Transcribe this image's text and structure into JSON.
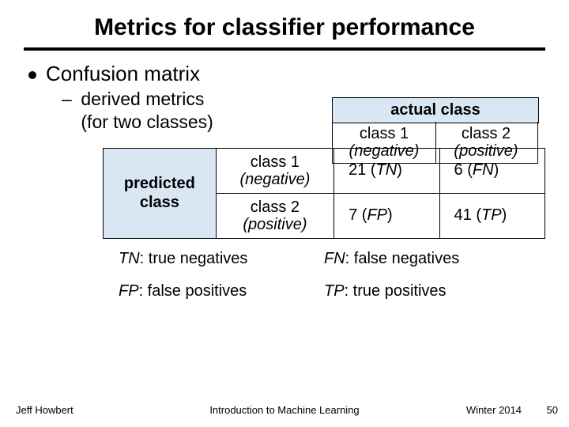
{
  "title": "Metrics for classifier performance",
  "bullet": "Confusion matrix",
  "sub_bullet_line1": "derived metrics",
  "sub_bullet_line2": "(for two classes)",
  "table": {
    "actual_header": "actual class",
    "predicted_header_line1": "predicted",
    "predicted_header_line2": "class",
    "col1_label": "class 1",
    "col1_paren": "(negative)",
    "col2_label": "class 2",
    "col2_paren": "(positive)",
    "row1_label": "class 1",
    "row1_paren": "(negative)",
    "row2_label": "class 2",
    "row2_paren": "(positive)",
    "cells": {
      "r1c1_num": "21",
      "r1c1_abbr": "TN",
      "r1c2_num": "6",
      "r1c2_abbr": "FN",
      "r2c1_num": "7",
      "r2c1_abbr": "FP",
      "r2c2_num": "41",
      "r2c2_abbr": "TP"
    }
  },
  "legend": {
    "tn_abbr": "TN",
    "tn_text": ": true negatives",
    "fn_abbr": "FN",
    "fn_text": ": false negatives",
    "fp_abbr": "FP",
    "fp_text": ": false positives",
    "tp_abbr": "TP",
    "tp_text": ": true positives"
  },
  "footer": {
    "author": "Jeff Howbert",
    "course": "Introduction to Machine Learning",
    "term": "Winter 2014",
    "page": "50"
  },
  "chart_data": {
    "type": "table",
    "title": "Confusion matrix (two classes)",
    "row_label": "predicted class",
    "col_label": "actual class",
    "rows": [
      "class 1 (negative)",
      "class 2 (positive)"
    ],
    "cols": [
      "class 1 (negative)",
      "class 2 (positive)"
    ],
    "values": [
      [
        21,
        6
      ],
      [
        7,
        41
      ]
    ],
    "cell_labels": [
      [
        "TN",
        "FN"
      ],
      [
        "FP",
        "TP"
      ]
    ]
  }
}
